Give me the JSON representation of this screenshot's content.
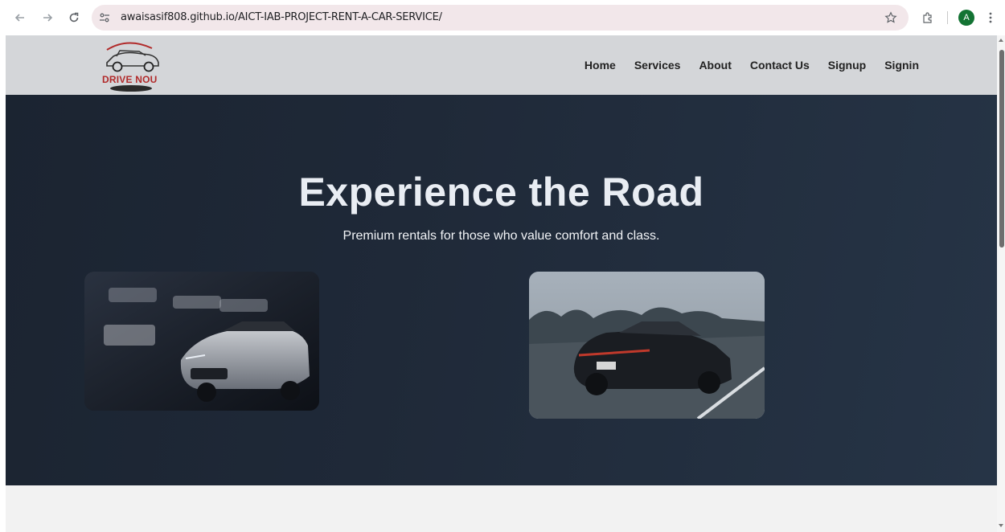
{
  "browser": {
    "url": "awaisasif808.github.io/AICT-IAB-PROJECT-RENT-A-CAR-SERVICE/",
    "profile_initial": "A",
    "colors": {
      "omnibox": "#f2e7ea",
      "profile": "#137333"
    }
  },
  "site": {
    "logo_text": "DRIVE NOU",
    "nav": [
      "Home",
      "Services",
      "About",
      "Contact Us",
      "Signup",
      "Signin"
    ],
    "hero": {
      "title": "Experience the Road",
      "subtitle": "Premium rentals for those who value comfort and class."
    },
    "colors": {
      "header_bg": "#d4d6d9",
      "hero_bg": "#1f2938",
      "logo_red": "#b12a2a"
    }
  }
}
